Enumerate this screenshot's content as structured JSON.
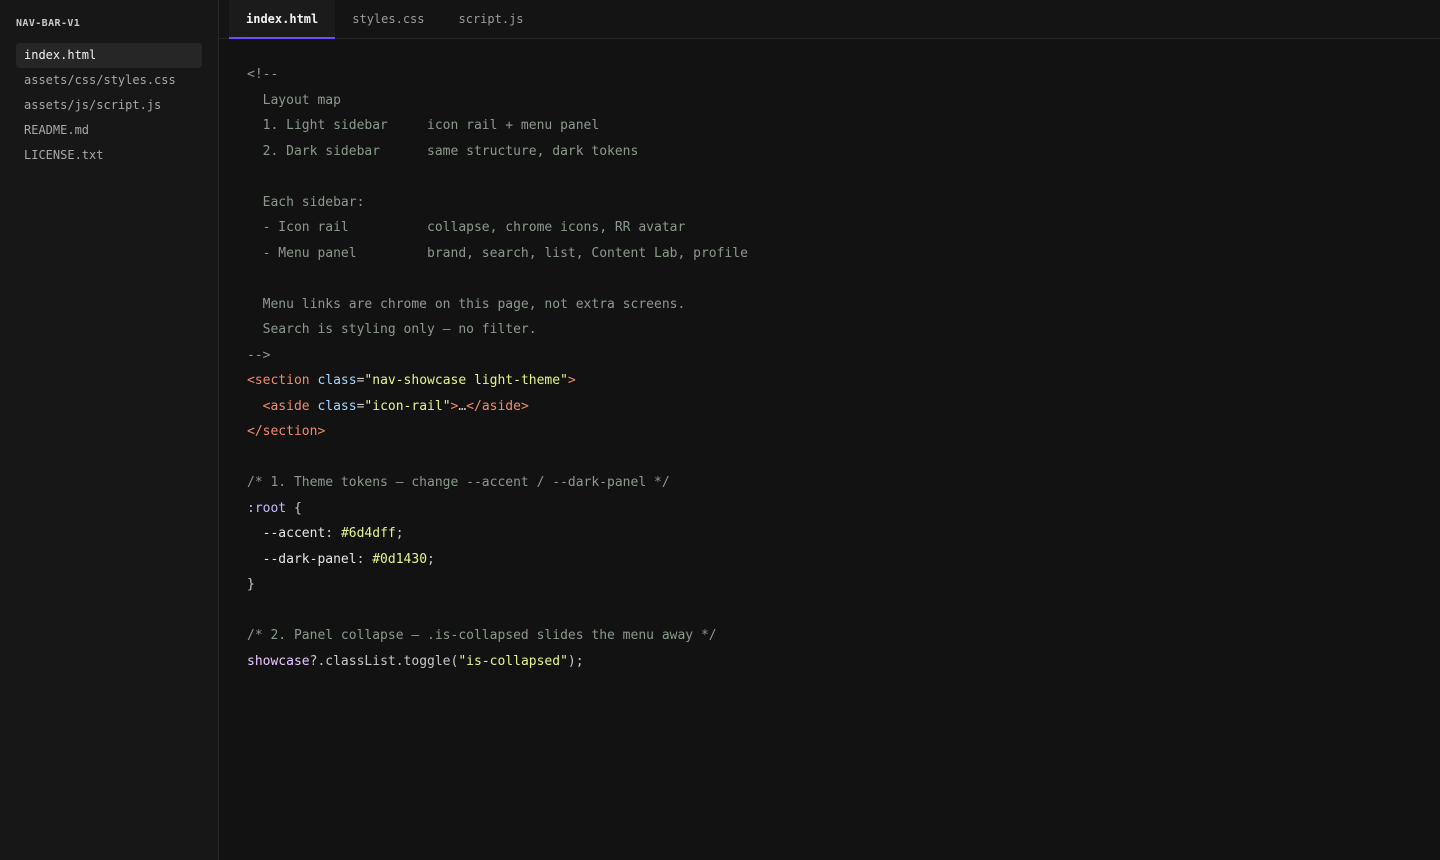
{
  "sidebar": {
    "project_title": "NAV-BAR-V1",
    "files": [
      {
        "label": "index.html",
        "active": true
      },
      {
        "label": "assets/css/styles.css",
        "active": false
      },
      {
        "label": "assets/js/script.js",
        "active": false
      },
      {
        "label": "README.md",
        "active": false
      },
      {
        "label": "LICENSE.txt",
        "active": false
      }
    ]
  },
  "tabs": [
    {
      "label": "index.html",
      "active": true
    },
    {
      "label": "styles.css",
      "active": false
    },
    {
      "label": "script.js",
      "active": false
    }
  ],
  "accent_color": "#6d4dff",
  "code": [
    [
      {
        "t": "<!--",
        "k": "comment"
      }
    ],
    [
      {
        "t": "  Layout map",
        "k": "comment"
      }
    ],
    [
      {
        "t": "  1. Light sidebar     icon rail + menu panel",
        "k": "comment"
      }
    ],
    [
      {
        "t": "  2. Dark sidebar      same structure, dark tokens",
        "k": "comment"
      }
    ],
    [],
    [
      {
        "t": "  Each sidebar:",
        "k": "comment"
      }
    ],
    [
      {
        "t": "  - Icon rail          collapse, chrome icons, RR avatar",
        "k": "comment"
      }
    ],
    [
      {
        "t": "  - Menu panel         brand, search, list, Content Lab, profile",
        "k": "comment"
      }
    ],
    [],
    [
      {
        "t": "  Menu links are chrome on this page, not extra screens.",
        "k": "comment"
      }
    ],
    [
      {
        "t": "  Search is styling only — no filter.",
        "k": "comment"
      }
    ],
    [
      {
        "t": "-->",
        "k": "comment"
      }
    ],
    [
      {
        "t": "<section",
        "k": "tag"
      },
      {
        "t": " ",
        "k": "punc"
      },
      {
        "t": "class",
        "k": "attr"
      },
      {
        "t": "=",
        "k": "punc"
      },
      {
        "t": "\"nav-showcase light-theme\"",
        "k": "str"
      },
      {
        "t": ">",
        "k": "tag"
      }
    ],
    [
      {
        "t": "  ",
        "k": "punc"
      },
      {
        "t": "<aside",
        "k": "tag"
      },
      {
        "t": " ",
        "k": "punc"
      },
      {
        "t": "class",
        "k": "attr"
      },
      {
        "t": "=",
        "k": "punc"
      },
      {
        "t": "\"icon-rail\"",
        "k": "str"
      },
      {
        "t": ">",
        "k": "tag"
      },
      {
        "t": "…",
        "k": "punc"
      },
      {
        "t": "</aside>",
        "k": "tag"
      }
    ],
    [
      {
        "t": "</section>",
        "k": "tag"
      }
    ],
    [],
    [
      {
        "t": "/* 1. Theme tokens — change --accent / --dark-panel */",
        "k": "comment"
      }
    ],
    [
      {
        "t": ":root",
        "k": "sel"
      },
      {
        "t": " {",
        "k": "punc"
      }
    ],
    [
      {
        "t": "  --accent",
        "k": "prop"
      },
      {
        "t": ": ",
        "k": "punc"
      },
      {
        "t": "#6d4dff",
        "k": "val"
      },
      {
        "t": ";",
        "k": "punc"
      }
    ],
    [
      {
        "t": "  --dark-panel",
        "k": "prop"
      },
      {
        "t": ": ",
        "k": "punc"
      },
      {
        "t": "#0d1430",
        "k": "val"
      },
      {
        "t": ";",
        "k": "punc"
      }
    ],
    [
      {
        "t": "}",
        "k": "punc"
      }
    ],
    [],
    [
      {
        "t": "/* 2. Panel collapse — .is-collapsed slides the menu away */",
        "k": "comment"
      }
    ],
    [
      {
        "t": "showcase",
        "k": "id"
      },
      {
        "t": "?.classList.toggle(",
        "k": "punc"
      },
      {
        "t": "\"is-collapsed\"",
        "k": "str"
      },
      {
        "t": ");",
        "k": "punc"
      }
    ]
  ]
}
